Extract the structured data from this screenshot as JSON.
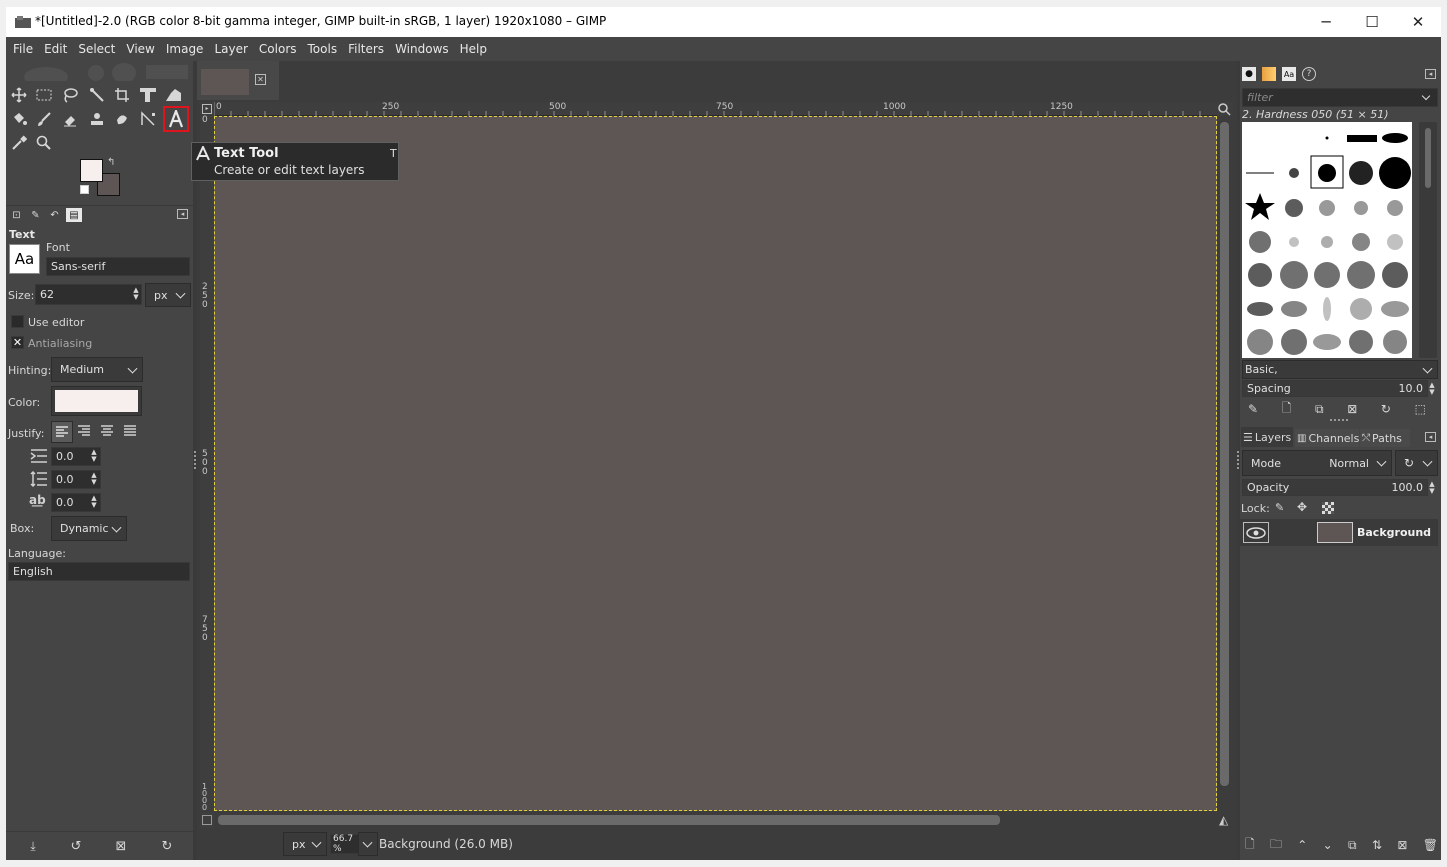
{
  "window": {
    "title": "*[Untitled]-2.0 (RGB color 8-bit gamma integer, GIMP built-in sRGB, 1 layer) 1920x1080 – GIMP",
    "min_glyph": "─",
    "max_glyph": "☐",
    "close_glyph": "✕"
  },
  "menu": [
    "File",
    "Edit",
    "Select",
    "View",
    "Image",
    "Layer",
    "Colors",
    "Tools",
    "Filters",
    "Windows",
    "Help"
  ],
  "tool_options": {
    "section_title": "Text",
    "font_label": "Font",
    "font_preview": "Aa",
    "font_value": "Sans-serif",
    "size_label": "Size:",
    "size_value": "62",
    "size_unit": "px",
    "use_editor_label": "Use editor",
    "use_editor_checked": false,
    "antialiasing_label": "Antialiasing",
    "antialiasing_checked": true,
    "hinting_label": "Hinting:",
    "hinting_value": "Medium",
    "color_label": "Color:",
    "color_value": "#f7eeee",
    "justify_label": "Justify:",
    "indent_value": "0.0",
    "line_spacing_value": "0.0",
    "letter_spacing_value": "0.0",
    "box_label": "Box:",
    "box_value": "Dynamic",
    "language_label": "Language:",
    "language_value": "English"
  },
  "tooltip": {
    "title": "Text Tool",
    "shortcut": "T",
    "description": "Create or edit text layers"
  },
  "ruler": {
    "h_ticks": [
      "0",
      "250",
      "500",
      "750",
      "1000",
      "1250"
    ],
    "v_ticks": [
      "0",
      "250",
      "500",
      "750",
      "1000"
    ]
  },
  "statusbar": {
    "unit": "px",
    "zoom": "66.7 %",
    "info": "Background (26.0 MB)"
  },
  "brushes": {
    "filter_placeholder": "filter",
    "selected_brush": "2. Hardness 050 (51 × 51)",
    "tag_value": "Basic,",
    "spacing_label": "Spacing",
    "spacing_value": "10.0"
  },
  "layers": {
    "tabs": [
      "Layers",
      "Channels",
      "Paths"
    ],
    "mode_label": "Mode",
    "mode_value": "Normal",
    "opacity_label": "Opacity",
    "opacity_value": "100.0",
    "lock_label": "Lock:",
    "layer_name": "Background"
  },
  "colors": {
    "fg": "#f7eeee",
    "bg": "#5e5555",
    "highlight": "#e0141e",
    "panel": "#454545"
  }
}
